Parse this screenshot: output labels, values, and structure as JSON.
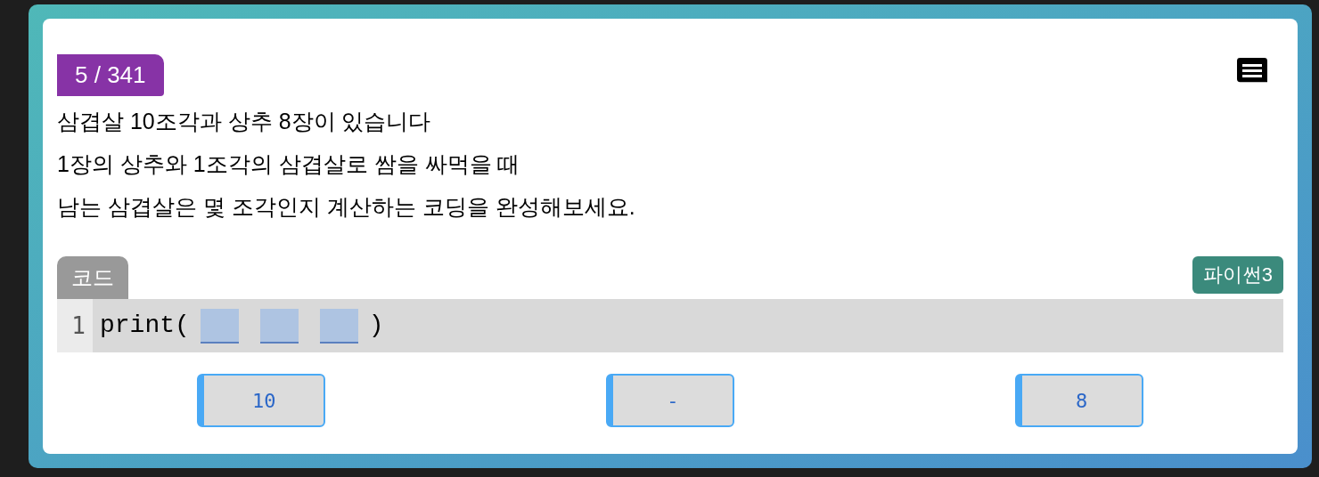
{
  "progress": "5 / 341",
  "question": [
    "삼겹살 10조각과 상추 8장이 있습니다",
    "1장의 상추와 1조각의 삼겹살로 쌈을 싸먹을 때",
    "남는 삼겹살은 몇 조각인지 계산하는 코딩을 완성해보세요."
  ],
  "code_tab": "코드",
  "language": "파이썬3",
  "code_lines": [
    {
      "number": "1",
      "tokens": [
        {
          "kind": "text",
          "text": "print("
        },
        {
          "kind": "blank"
        },
        {
          "kind": "blank"
        },
        {
          "kind": "blank"
        },
        {
          "kind": "text",
          "text": ")"
        }
      ]
    }
  ],
  "choices": [
    "10",
    "-",
    "8"
  ]
}
